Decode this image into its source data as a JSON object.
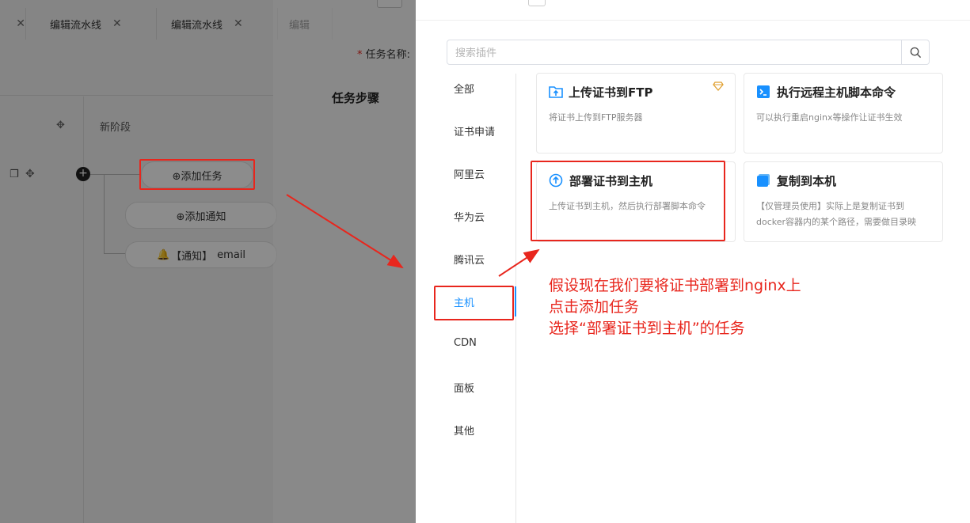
{
  "tabs": [
    {
      "label": ""
    },
    {
      "label": "编辑流水线"
    },
    {
      "label": "编辑流水线"
    },
    {
      "label": "编辑"
    }
  ],
  "pipeline": {
    "stage_title": "新阶段",
    "add_task": "⊕添加任务",
    "add_notify": "⊕添加通知",
    "notify_prefix": "【通知】",
    "notify_name": "email"
  },
  "form": {
    "task_name_label": "任务名称:",
    "task_steps_label": "任务步骤"
  },
  "search": {
    "placeholder": "搜索插件"
  },
  "categories": [
    {
      "label": "全部"
    },
    {
      "label": "证书申请"
    },
    {
      "label": "阿里云"
    },
    {
      "label": "华为云"
    },
    {
      "label": "腾讯云"
    },
    {
      "label": "主机"
    },
    {
      "label": "CDN"
    },
    {
      "label": "面板"
    },
    {
      "label": "其他"
    }
  ],
  "plugins": [
    {
      "title": "上传证书到FTP",
      "desc": "将证书上传到FTP服务器",
      "icon": "upload-folder-icon",
      "vip": true
    },
    {
      "title": "执行远程主机脚本命令",
      "desc": "可以执行重启nginx等操作让证书生效",
      "icon": "terminal-icon",
      "vip": false
    },
    {
      "title": "部署证书到主机",
      "desc": "上传证书到主机，然后执行部署脚本命令",
      "icon": "upload-circle-icon",
      "vip": false
    },
    {
      "title": "复制到本机",
      "desc": "【仅管理员使用】实际上是复制证书到docker容器内的某个路径，需要做目录映",
      "icon": "copy-cube-icon",
      "vip": false
    }
  ],
  "annotation": {
    "line1": "假设现在我们要将证书部署到nginx上",
    "line2": "点击添加任务",
    "line3": "选择“部署证书到主机”的任务"
  },
  "colors": {
    "accent": "#1890ff",
    "annotation_red": "#e8261d",
    "vip_gold": "#e0a030"
  }
}
